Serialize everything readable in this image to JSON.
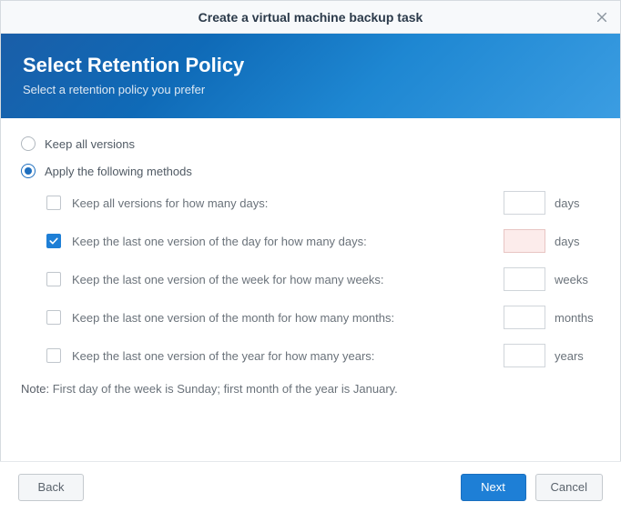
{
  "titlebar": {
    "title": "Create a virtual machine backup task"
  },
  "banner": {
    "heading": "Select Retention Policy",
    "subheading": "Select a retention policy you prefer"
  },
  "radios": {
    "keep_all": "Keep all versions",
    "apply_methods": "Apply the following methods",
    "selected": "apply_methods"
  },
  "methods": [
    {
      "label": "Keep all versions for how many days:",
      "checked": false,
      "value": "",
      "unit": "days",
      "error": false
    },
    {
      "label": "Keep the last one version of the day for how many days:",
      "checked": true,
      "value": "",
      "unit": "days",
      "error": true
    },
    {
      "label": "Keep the last one version of the week for how many weeks:",
      "checked": false,
      "value": "",
      "unit": "weeks",
      "error": false
    },
    {
      "label": "Keep the last one version of the month for how many months:",
      "checked": false,
      "value": "",
      "unit": "months",
      "error": false
    },
    {
      "label": "Keep the last one version of the year for how many years:",
      "checked": false,
      "value": "",
      "unit": "years",
      "error": false
    }
  ],
  "note": {
    "label": "Note:",
    "text": "First day of the week is Sunday; first month of the year is January."
  },
  "footer": {
    "back": "Back",
    "next": "Next",
    "cancel": "Cancel"
  }
}
